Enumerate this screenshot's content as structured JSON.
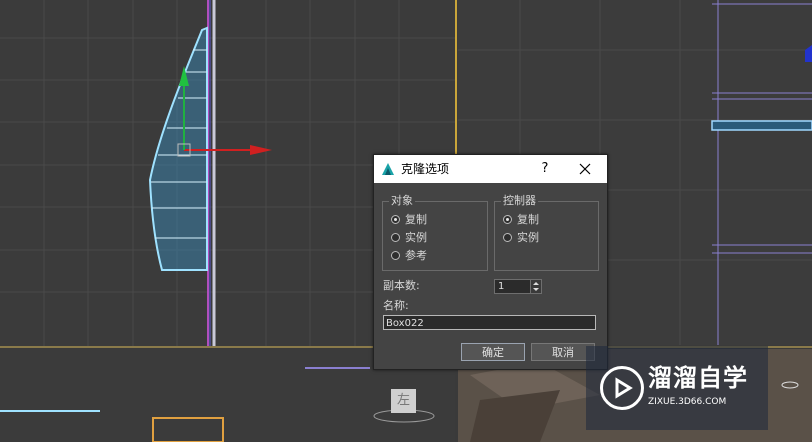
{
  "dialog": {
    "title": "克隆选项",
    "help": "?",
    "object_group": {
      "legend": "对象",
      "options": [
        {
          "label": "复制",
          "selected": true
        },
        {
          "label": "实例",
          "selected": false
        },
        {
          "label": "参考",
          "selected": false
        }
      ]
    },
    "controller_group": {
      "legend": "控制器",
      "options": [
        {
          "label": "复制",
          "selected": true
        },
        {
          "label": "实例",
          "selected": false
        }
      ]
    },
    "copies_label": "副本数:",
    "copies_value": "1",
    "name_label": "名称:",
    "name_value": "Box022",
    "ok_label": "确定",
    "cancel_label": "取消"
  },
  "viewport": {
    "orientation_label": "左"
  },
  "watermark": {
    "brand": "溜溜自学",
    "url": "ZIXUE.3D66.COM"
  }
}
